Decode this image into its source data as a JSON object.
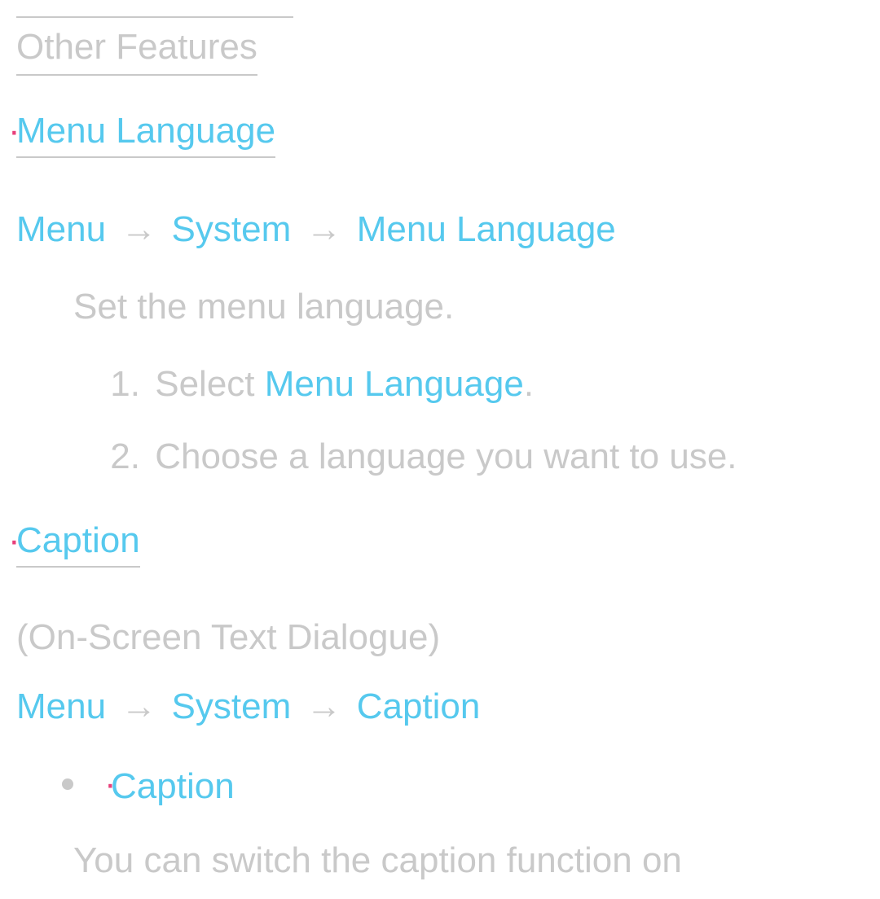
{
  "title": "Other Features",
  "section1": {
    "anchor": "·",
    "heading": "Menu Language",
    "path": {
      "p1": "Menu",
      "a1": "→",
      "p2": "System",
      "a2": "→",
      "p3": "Menu Language"
    },
    "desc": "Set the menu language.",
    "steps": {
      "s1": {
        "num": "1.",
        "pre": "Select ",
        "hl": "Menu Language",
        "post": "."
      },
      "s2": {
        "num": "2.",
        "text": "Choose a language you want to use."
      }
    }
  },
  "section2": {
    "anchor": "·",
    "heading": "Caption",
    "subtitle": "(On-Screen Text Dialogue)",
    "path": {
      "p1": "Menu",
      "a1": "→",
      "p2": "System",
      "a2": "→",
      "p3": "Caption"
    },
    "bullet": {
      "anchor": "·",
      "label": "Caption"
    },
    "body": "You can switch the caption function on"
  }
}
